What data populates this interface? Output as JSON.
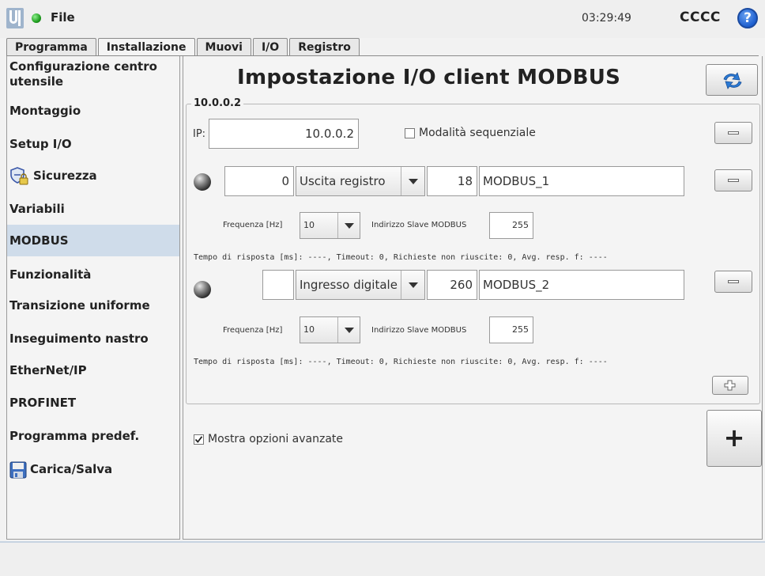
{
  "topbar": {
    "file_label": "File",
    "clock": "03:29:49",
    "robot_name": "CCCC",
    "help_symbol": "?"
  },
  "tabs": [
    {
      "label": "Programma",
      "active": false
    },
    {
      "label": "Installazione",
      "active": true
    },
    {
      "label": "Muovi",
      "active": false
    },
    {
      "label": "I/O",
      "active": false
    },
    {
      "label": "Registro",
      "active": false
    }
  ],
  "sidebar": {
    "items": [
      {
        "label": "Configurazione centro utensile",
        "selected": false,
        "icon": null
      },
      {
        "label": "Montaggio",
        "selected": false,
        "icon": null
      },
      {
        "label": "Setup I/O",
        "selected": false,
        "icon": null
      },
      {
        "label": "Sicurezza",
        "selected": false,
        "icon": "shield-lock-icon"
      },
      {
        "label": "Variabili",
        "selected": false,
        "icon": null
      },
      {
        "label": "MODBUS",
        "selected": true,
        "icon": null
      },
      {
        "label": "Funzionalità",
        "selected": false,
        "icon": null
      },
      {
        "label": "Transizione uniforme",
        "selected": false,
        "icon": null
      },
      {
        "label": "Inseguimento nastro",
        "selected": false,
        "icon": null
      },
      {
        "label": "EtherNet/IP",
        "selected": false,
        "icon": null
      },
      {
        "label": "PROFINET",
        "selected": false,
        "icon": null
      },
      {
        "label": "Programma predef.",
        "selected": false,
        "icon": null
      },
      {
        "label": "Carica/Salva",
        "selected": false,
        "icon": "floppy-disk-icon"
      }
    ]
  },
  "main": {
    "title": "Impostazione I/O client MODBUS",
    "group_title": "10.0.0.2",
    "ip_label": "IP:",
    "ip_value": "10.0.0.2",
    "sequential_label": "Modalità sequenziale",
    "sequential_checked": false,
    "signals": [
      {
        "address": "0",
        "type": "Uscita registro",
        "register": "18",
        "name": "MODBUS_1",
        "freq_label": "Frequenza [Hz]",
        "freq_value": "10",
        "slave_label": "Indirizzo Slave MODBUS",
        "slave_value": "255",
        "status_line": "Tempo di risposta [ms]: ----, Timeout: 0, Richieste non riuscite: 0, Avg. resp. f: ----"
      },
      {
        "address": "",
        "type": "Ingresso digitale",
        "register": "260",
        "name": "MODBUS_2",
        "freq_label": "Frequenza [Hz]",
        "freq_value": "10",
        "slave_label": "Indirizzo Slave MODBUS",
        "slave_value": "255",
        "status_line": "Tempo di risposta [ms]: ----, Timeout: 0, Richieste non riuscite: 0, Avg. resp. f: ----"
      }
    ],
    "advanced_label": "Mostra opzioni avanzate",
    "advanced_checked": true,
    "add_big_symbol": "+"
  },
  "colors": {
    "selected_bg": "#cfdcea",
    "status_green": "#1f9e1f",
    "help_blue": "#1d5fcf"
  }
}
